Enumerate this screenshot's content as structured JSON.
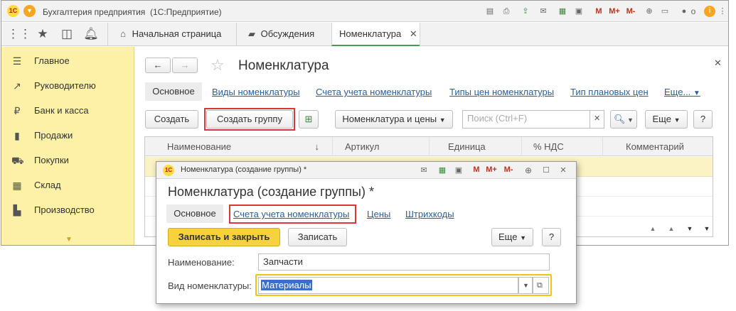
{
  "app": {
    "title": "Бухгалтерия предприятия",
    "edition": "(1С:Предприятие)",
    "user_initial": "о",
    "logo_text": "1С"
  },
  "titlebar_icons": [
    "save-icon",
    "print-icon",
    "upload-icon",
    "mail-icon",
    "calc-icon",
    "calendar-icon",
    "memory-m-icon",
    "memory-mplus-icon",
    "memory-mminus-icon",
    "zoom-icon",
    "window-icon",
    "user-icon",
    "info-icon",
    "menu-icon"
  ],
  "titlebar_texts": {
    "m": "M",
    "mplus": "M+",
    "mminus": "M-"
  },
  "tabs": [
    {
      "label": "Начальная страница"
    },
    {
      "label": "Обсуждения"
    },
    {
      "label": "Номенклатура"
    }
  ],
  "sidebar": {
    "items": [
      {
        "label": "Главное"
      },
      {
        "label": "Руководителю"
      },
      {
        "label": "Банк и касса"
      },
      {
        "label": "Продажи"
      },
      {
        "label": "Покупки"
      },
      {
        "label": "Склад"
      },
      {
        "label": "Производство"
      }
    ]
  },
  "page": {
    "title": "Номенклатура",
    "nav_links": [
      {
        "label": "Основное"
      },
      {
        "label": "Виды номенклатуры"
      },
      {
        "label": "Счета учета номенклатуры"
      },
      {
        "label": "Типы цен номенклатуры"
      },
      {
        "label": "Тип плановых цен"
      },
      {
        "label": "Еще..."
      }
    ],
    "toolbar": {
      "create": "Создать",
      "create_group": "Создать группу",
      "nomenclature_prices": "Номенклатура и цены",
      "search_placeholder": "Поиск (Ctrl+F)",
      "more": "Еще",
      "help": "?"
    },
    "table_headers": [
      {
        "label": "Наименование"
      },
      {
        "label": "Артикул"
      },
      {
        "label": "Единица"
      },
      {
        "label": "% НДС"
      },
      {
        "label": "Комментарий"
      }
    ]
  },
  "dialog": {
    "title": "Номенклатура (создание группы) *",
    "heading": "Номенклатура (создание группы) *",
    "tabs": [
      {
        "label": "Основное"
      },
      {
        "label": "Счета учета номенклатуры"
      },
      {
        "label": "Цены"
      },
      {
        "label": "Штрихкоды"
      }
    ],
    "save_close": "Записать и закрыть",
    "save": "Записать",
    "more": "Еще",
    "help": "?",
    "name_label": "Наименование:",
    "name_value": "Запчасти",
    "kind_label": "Вид номенклатуры:",
    "kind_value": "Материалы",
    "title_m": "M",
    "title_mplus": "M+",
    "title_mminus": "M-"
  },
  "colors": {
    "sidebar_bg": "#fcf1a6",
    "accent_yellow": "#f7d23c",
    "highlight_red": "#d9373a",
    "link": "#2e5e96",
    "selected_row": "#fbf3c4"
  }
}
